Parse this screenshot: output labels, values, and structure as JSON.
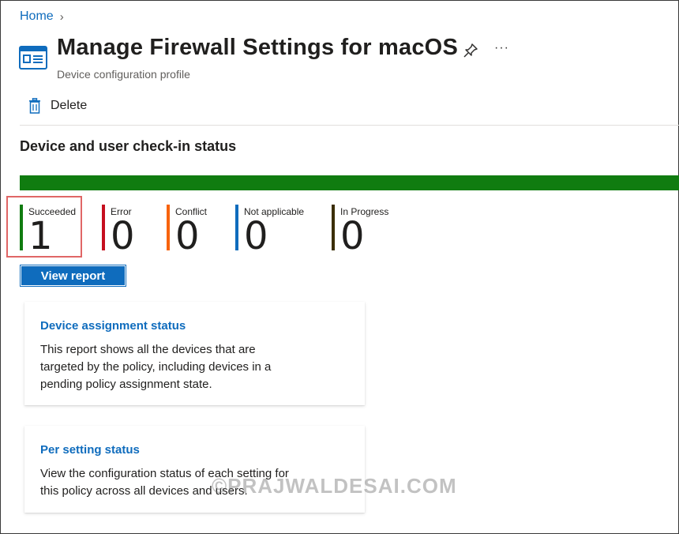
{
  "breadcrumb": {
    "home": "Home",
    "separator": "›"
  },
  "header": {
    "title": "Manage Firewall Settings for macOS",
    "subtitle": "Device configuration profile",
    "icon": "device-configuration-profile-icon",
    "more": "···"
  },
  "toolbar": {
    "delete_label": "Delete",
    "delete_icon": "trash-icon"
  },
  "status": {
    "section_title": "Device and user check-in status",
    "bar_color": "#107c10",
    "items": [
      {
        "label": "Succeeded",
        "value": "1",
        "color": "#107c10"
      },
      {
        "label": "Error",
        "value": "0",
        "color": "#c50f1f"
      },
      {
        "label": "Conflict",
        "value": "0",
        "color": "#f7630c"
      },
      {
        "label": "Not applicable",
        "value": "0",
        "color": "#0f6cbd"
      },
      {
        "label": "In Progress",
        "value": "0",
        "color": "#3b2e04"
      }
    ],
    "view_report_label": "View report"
  },
  "cards": [
    {
      "title": "Device assignment status",
      "description": "This report shows all the devices that are targeted by the policy, including devices in a pending policy assignment state."
    },
    {
      "title": "Per setting status",
      "description": "View the configuration status of each setting for this policy across all devices and users."
    }
  ],
  "watermark": "©PRAJWALDESAI.COM",
  "colors": {
    "accent": "#0f6cbd",
    "highlight": "#e06666"
  }
}
